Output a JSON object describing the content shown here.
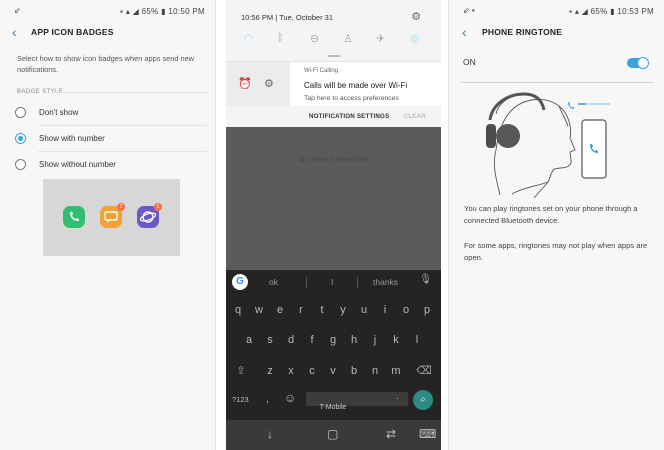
{
  "screen1": {
    "status_time": "10:50 PM",
    "status_battery": "65%",
    "title": "APP ICON BADGES",
    "description": "Select how to show icon badges when apps send new notifications.",
    "section_label": "BADGE STYLE",
    "options": [
      {
        "label": "Don't show",
        "selected": false
      },
      {
        "label": "Show with number",
        "selected": true
      },
      {
        "label": "Show without number",
        "selected": false
      }
    ],
    "preview_badge_count": "1",
    "accent_color": "#3aa3dc"
  },
  "screen2": {
    "time": "10:56 PM",
    "date": "Tue, October 31",
    "notification": {
      "app": "Wi-Fi Calling",
      "title": "Calls will be made over Wi-Fi",
      "subtitle": "Tap here to access preferences"
    },
    "notification_settings_label": "NOTIFICATION SETTINGS",
    "clear_label": "CLEAR",
    "no_recent": "No recent searches",
    "keyboard": {
      "suggestions": [
        "ok",
        "I",
        "thanks"
      ],
      "row1": [
        "q",
        "w",
        "e",
        "r",
        "t",
        "y",
        "u",
        "i",
        "o",
        "p"
      ],
      "row2": [
        "a",
        "s",
        "d",
        "f",
        "g",
        "h",
        "j",
        "k",
        "l"
      ],
      "row3": [
        "z",
        "x",
        "c",
        "v",
        "b",
        "n",
        "m"
      ],
      "num_key": "?123",
      "comma": ",",
      "period": ".",
      "carrier": "T-Mobile"
    }
  },
  "screen3": {
    "status_time": "10:53 PM",
    "status_battery": "65%",
    "title": "PHONE RINGTONE",
    "on_label": "ON",
    "toggle_on": true,
    "text1": "You can play ringtones set on your phone through a connected Bluetooth device.",
    "text2": "For some apps, ringtones may not play when apps are open."
  }
}
